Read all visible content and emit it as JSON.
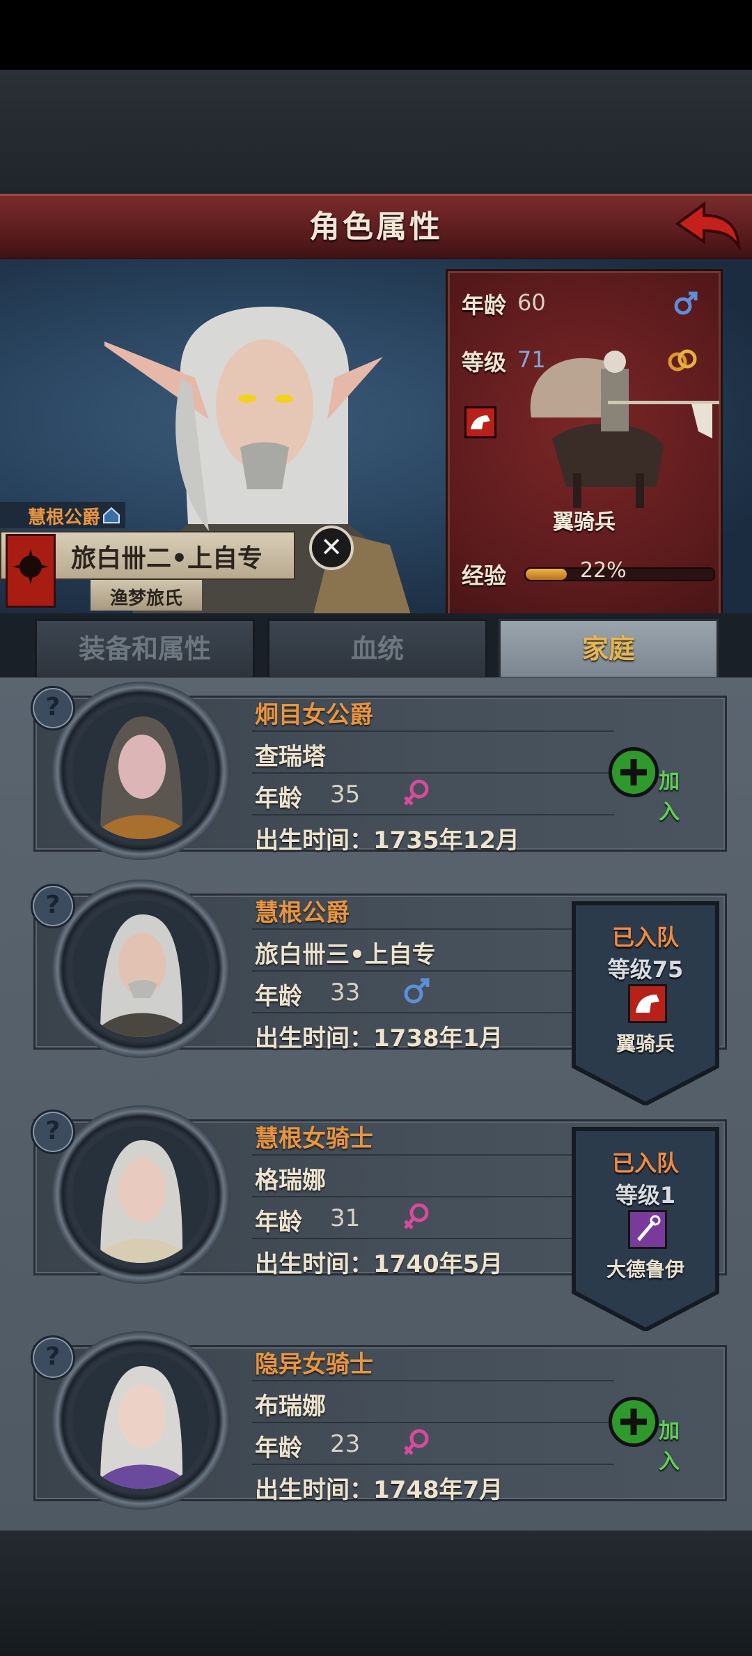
{
  "header": {
    "title": "角色属性"
  },
  "character": {
    "title": "慧根公爵",
    "name": "旅白卌二•上自专",
    "clan": "渔梦旅氏"
  },
  "stats": {
    "age_label": "年龄",
    "age": "60",
    "level_label": "等级",
    "level": "71",
    "unit_name": "翼骑兵",
    "exp_label": "经验",
    "exp_percent": "22%",
    "exp_value": 0.22,
    "gender_icon": "male-icon",
    "ring_icon": "rings-icon"
  },
  "tabs": [
    {
      "label": "装备和属性",
      "active": false
    },
    {
      "label": "血统",
      "active": false
    },
    {
      "label": "家庭",
      "active": true
    }
  ],
  "family": [
    {
      "title": "炯目女公爵",
      "name": "查瑞塔",
      "age_label": "年龄",
      "age": "35",
      "gender": "female",
      "birth": "出生时间：1735年12月",
      "action": "加入"
    },
    {
      "title": "慧根公爵",
      "name": "旅白卌三•上自专",
      "age_label": "年龄",
      "age": "33",
      "gender": "male",
      "birth": "出生时间：1738年1月",
      "team": {
        "status": "已入队",
        "level": "等级75",
        "unit": "翼骑兵"
      }
    },
    {
      "title": "慧根女骑士",
      "name": "格瑞娜",
      "age_label": "年龄",
      "age": "31",
      "gender": "female",
      "birth": "出生时间：1740年5月",
      "team": {
        "status": "已入队",
        "level": "等级1",
        "unit": "大德鲁伊"
      }
    },
    {
      "title": "隐异女骑士",
      "name": "布瑞娜",
      "age_label": "年龄",
      "age": "23",
      "gender": "female",
      "birth": "出生时间：1748年7月",
      "action": "加入"
    }
  ],
  "colors": {
    "accent_orange": "#e8953c",
    "active_tab": "#e8b64a",
    "add_green": "#5fd152",
    "header_red": "#6a2224"
  }
}
